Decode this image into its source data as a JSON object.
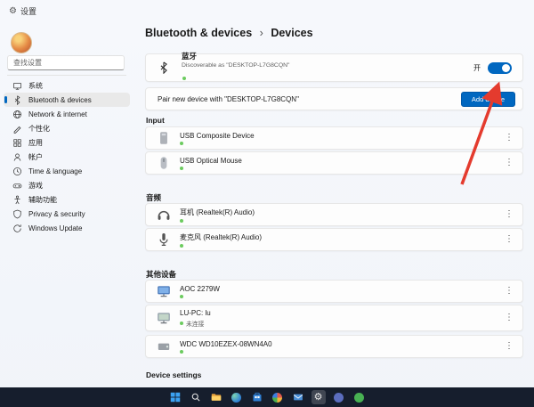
{
  "window": {
    "title": "设置"
  },
  "sidebar": {
    "search": {
      "placeholder": "查找设置"
    },
    "items": [
      {
        "label": "系统"
      },
      {
        "label": "Bluetooth & devices",
        "selected": true
      },
      {
        "label": "Network & internet"
      },
      {
        "label": "个性化"
      },
      {
        "label": "应用"
      },
      {
        "label": "帐户"
      },
      {
        "label": "Time & language"
      },
      {
        "label": "游戏"
      },
      {
        "label": "辅助功能"
      },
      {
        "label": "Privacy & security"
      },
      {
        "label": "Windows Update"
      }
    ]
  },
  "breadcrumb": {
    "parent": "Bluetooth & devices",
    "separator": "›",
    "current": "Devices"
  },
  "bluetooth": {
    "title": "蓝牙",
    "subtitle": "Discoverable as \"DESKTOP-L7G8CQN\"",
    "toggle_label": "开",
    "state": "on"
  },
  "pair": {
    "label": "Pair new device with \"DESKTOP-L7G8CQN\"",
    "button_label": "Add device"
  },
  "sections": [
    {
      "title": "Input",
      "devices": [
        {
          "name": "USB Composite Device"
        },
        {
          "name": "USB Optical Mouse"
        }
      ]
    },
    {
      "title": "音频",
      "devices": [
        {
          "name": "耳机 (Realtek(R) Audio)"
        },
        {
          "name": "麦克风 (Realtek(R) Audio)"
        }
      ]
    },
    {
      "title": "其他设备",
      "devices": [
        {
          "name": "AOC 2279W"
        },
        {
          "name": "LU-PC: lu",
          "status": "未连接"
        },
        {
          "name": "WDC WD10EZEX-08WN4A0"
        }
      ]
    }
  ],
  "footer": {
    "title": "Device settings"
  },
  "menu_overflow": "⋮",
  "colors": {
    "accent": "#0067c0",
    "status_green": "#6ccb5f",
    "arrow_red": "#e43b2e",
    "taskbar_bg": "#161e2d"
  },
  "taskbar": {
    "items": [
      {
        "name": "start"
      },
      {
        "name": "search"
      },
      {
        "name": "file-explorer"
      },
      {
        "name": "edge"
      },
      {
        "name": "store"
      },
      {
        "name": "photos"
      },
      {
        "name": "mail"
      },
      {
        "name": "settings",
        "active": true
      },
      {
        "name": "teams"
      },
      {
        "name": "chat"
      }
    ]
  }
}
